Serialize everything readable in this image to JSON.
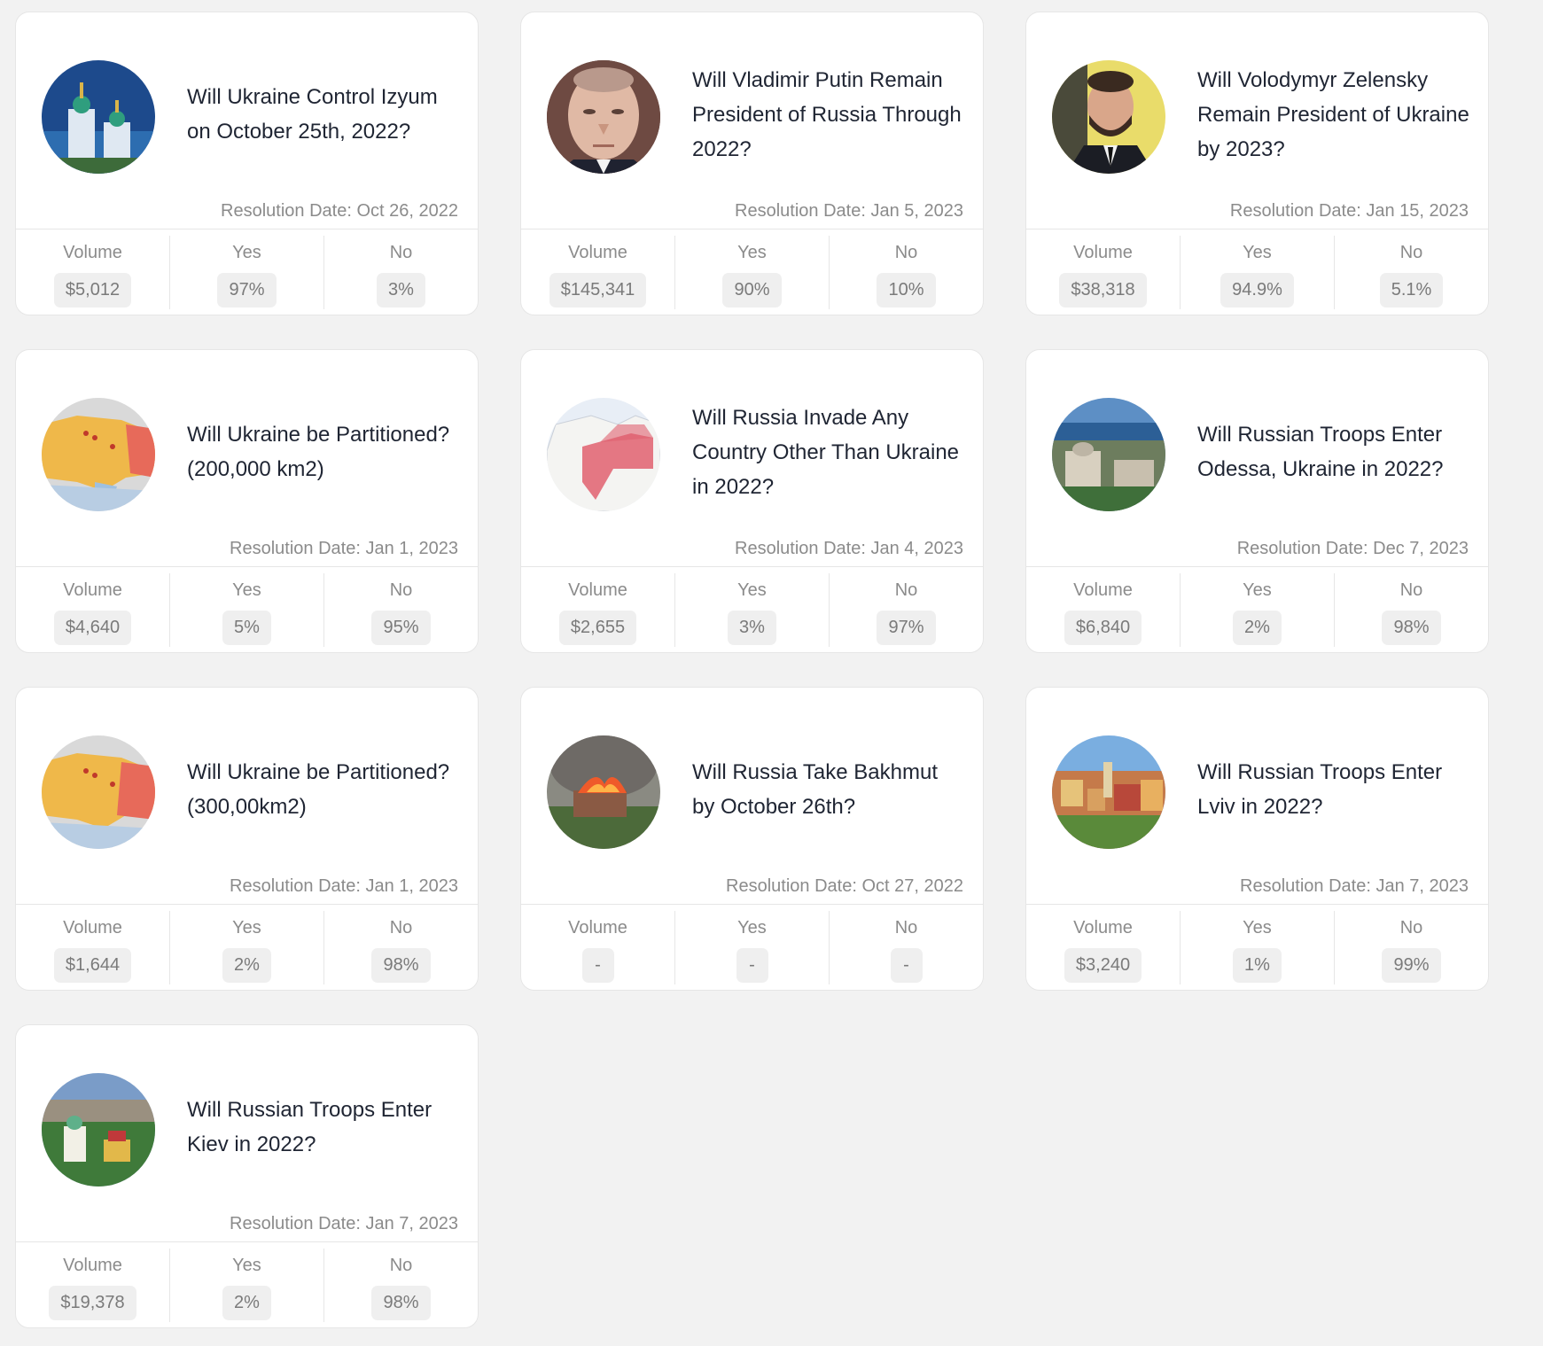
{
  "labels": {
    "volume": "Volume",
    "yes": "Yes",
    "no": "No"
  },
  "markets": [
    {
      "title": "Will Ukraine Control Izyum on October 25th, 2022?",
      "resolution": "Resolution Date: Oct 26, 2022",
      "volume": "$5,012",
      "yes": "97%",
      "no": "3%",
      "image": "church-image"
    },
    {
      "title": "Will Vladimir Putin Remain President of Russia Through 2022?",
      "resolution": "Resolution Date: Jan 5, 2023",
      "volume": "$145,341",
      "yes": "90%",
      "no": "10%",
      "image": "putin-portrait-image"
    },
    {
      "title": "Will Volodymyr Zelensky Remain President of Ukraine by 2023?",
      "resolution": "Resolution Date: Jan 15, 2023",
      "volume": "$38,318",
      "yes": "94.9%",
      "no": "5.1%",
      "image": "zelensky-portrait-image"
    },
    {
      "title": "Will Ukraine be Partitioned? (200,000 km2)",
      "resolution": "Resolution Date: Jan 1, 2023",
      "volume": "$4,640",
      "yes": "5%",
      "no": "95%",
      "image": "ukraine-map-image"
    },
    {
      "title": "Will Russia Invade Any Country Other Than Ukraine in 2022?",
      "resolution": "Resolution Date: Jan 4, 2023",
      "volume": "$2,655",
      "yes": "3%",
      "no": "97%",
      "image": "europe-map-image"
    },
    {
      "title": "Will Russian Troops Enter Odessa, Ukraine in 2022?",
      "resolution": "Resolution Date: Dec 7, 2023",
      "volume": "$6,840",
      "yes": "2%",
      "no": "98%",
      "image": "odessa-city-image"
    },
    {
      "title": "Will Ukraine be Partitioned? (300,00km2)",
      "resolution": "Resolution Date: Jan 1, 2023",
      "volume": "$1,644",
      "yes": "2%",
      "no": "98%",
      "image": "ukraine-map-image"
    },
    {
      "title": "Will Russia Take Bakhmut by October 26th?",
      "resolution": "Resolution Date: Oct 27, 2022",
      "volume": "-",
      "yes": "-",
      "no": "-",
      "image": "burning-building-image"
    },
    {
      "title": "Will Russian Troops Enter Lviv in 2022?",
      "resolution": "Resolution Date: Jan 7, 2023",
      "volume": "$3,240",
      "yes": "1%",
      "no": "99%",
      "image": "lviv-city-image"
    },
    {
      "title": "Will Russian Troops Enter Kiev in 2022?",
      "resolution": "Resolution Date: Jan 7, 2023",
      "volume": "$19,378",
      "yes": "2%",
      "no": "98%",
      "image": "kiev-city-image"
    }
  ]
}
